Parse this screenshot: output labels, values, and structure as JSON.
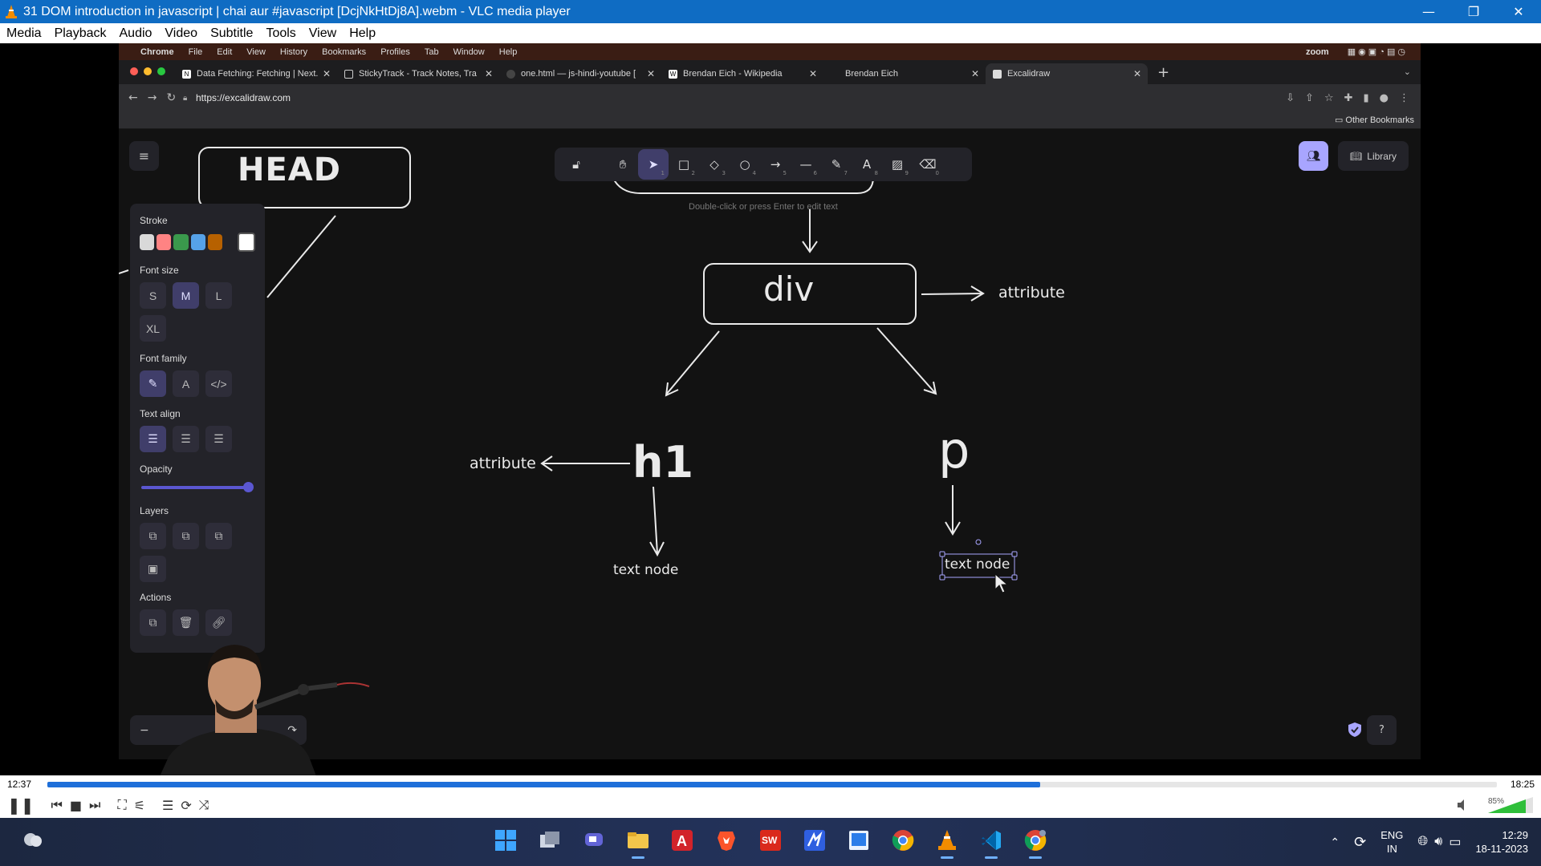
{
  "window": {
    "title": "31 DOM introduction in javascript  |  chai aur #javascript [DcjNkHtDj8A].webm - VLC media player"
  },
  "menu": [
    "Media",
    "Playback",
    "Audio",
    "Video",
    "Subtitle",
    "Tools",
    "View",
    "Help"
  ],
  "mac_menu": [
    "Chrome",
    "File",
    "Edit",
    "View",
    "History",
    "Bookmarks",
    "Profiles",
    "Tab",
    "Window",
    "Help"
  ],
  "mac_right": "zoom",
  "tabs": [
    {
      "label": "Data Fetching: Fetching | Next."
    },
    {
      "label": "StickyTrack - Track Notes, Tra"
    },
    {
      "label": "one.html — js-hindi-youtube ["
    },
    {
      "label": "Brendan Eich - Wikipedia"
    },
    {
      "label": "Brendan Eich"
    },
    {
      "label": "Excalidraw"
    }
  ],
  "url": "https://excalidraw.com",
  "other_bookmarks": "Other Bookmarks",
  "library_label": "Library",
  "hint": "Double-click or press Enter to edit text",
  "tool_keys": [
    "",
    "",
    "1",
    "2",
    "3",
    "4",
    "5",
    "6",
    "7",
    "8",
    "9",
    "0"
  ],
  "panel": {
    "stroke": "Stroke",
    "font_size": "Font size",
    "sizes": [
      "S",
      "M",
      "L",
      "XL"
    ],
    "font_family": "Font family",
    "text_align": "Text align",
    "opacity": "Opacity",
    "opacity_value": 1.0,
    "layers": "Layers",
    "actions": "Actions",
    "stroke_colors": [
      "#d9d9d9",
      "#ff8383",
      "#3a994c",
      "#56a2e8",
      "#b76100",
      "#ffffff"
    ]
  },
  "diagram": {
    "head": "HEAD",
    "div": "div",
    "attribute_right": "attribute",
    "h1": "h1",
    "attribute_left": "attribute",
    "p": "p",
    "text_node_left": "text node",
    "text_node_right": "text node"
  },
  "player": {
    "elapsed": "12:37",
    "total": "18:25",
    "progress": 0.685,
    "volume": "85%"
  },
  "tray": {
    "lang1": "ENG",
    "lang2": "IN",
    "time": "12:29",
    "date": "18-11-2023"
  }
}
